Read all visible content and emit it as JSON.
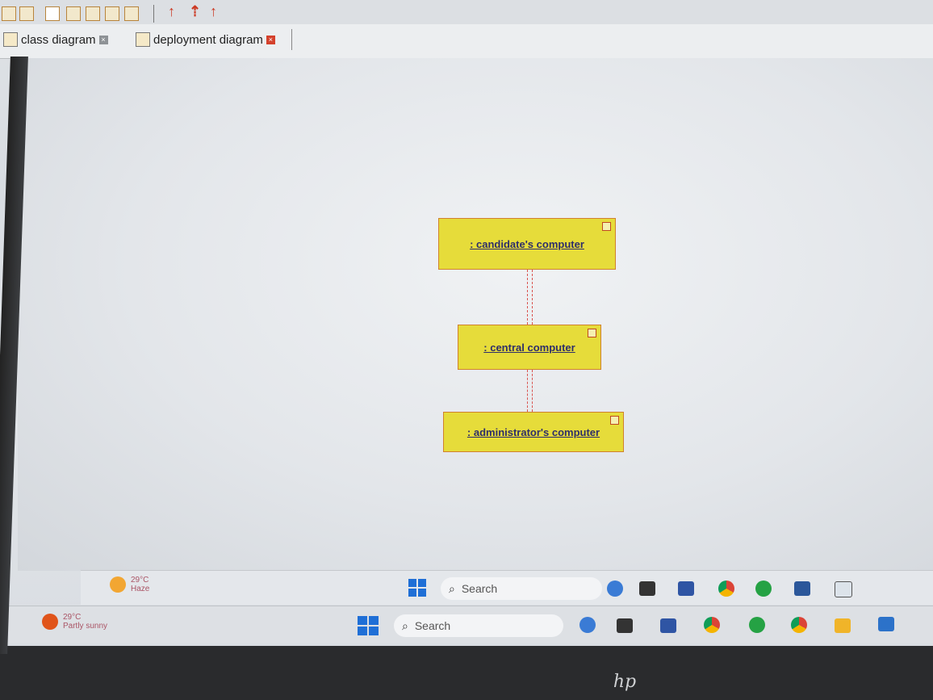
{
  "tabs": [
    {
      "label": "class diagram",
      "active": false
    },
    {
      "label": "deployment diagram",
      "active": true
    }
  ],
  "diagram": {
    "nodes": [
      {
        "label": ": candidate's computer"
      },
      {
        "label": ": central computer"
      },
      {
        "label": ": administrator's computer"
      }
    ],
    "node_fill": "#e6dc3a",
    "node_border": "#d0812e",
    "link_color": "#d9534f"
  },
  "taskbar_upper": {
    "temperature": "29°C",
    "condition": "Haze",
    "search_label": "Search"
  },
  "taskbar_lower": {
    "temperature": "29°C",
    "condition": "Partly sunny",
    "search_label": "Search"
  },
  "brand": "hp",
  "icons": [
    "bing-icon",
    "task-view-icon",
    "meet-icon",
    "chrome-icon",
    "whatsapp-icon",
    "word-icon",
    "files-icon",
    "photos-icon"
  ]
}
